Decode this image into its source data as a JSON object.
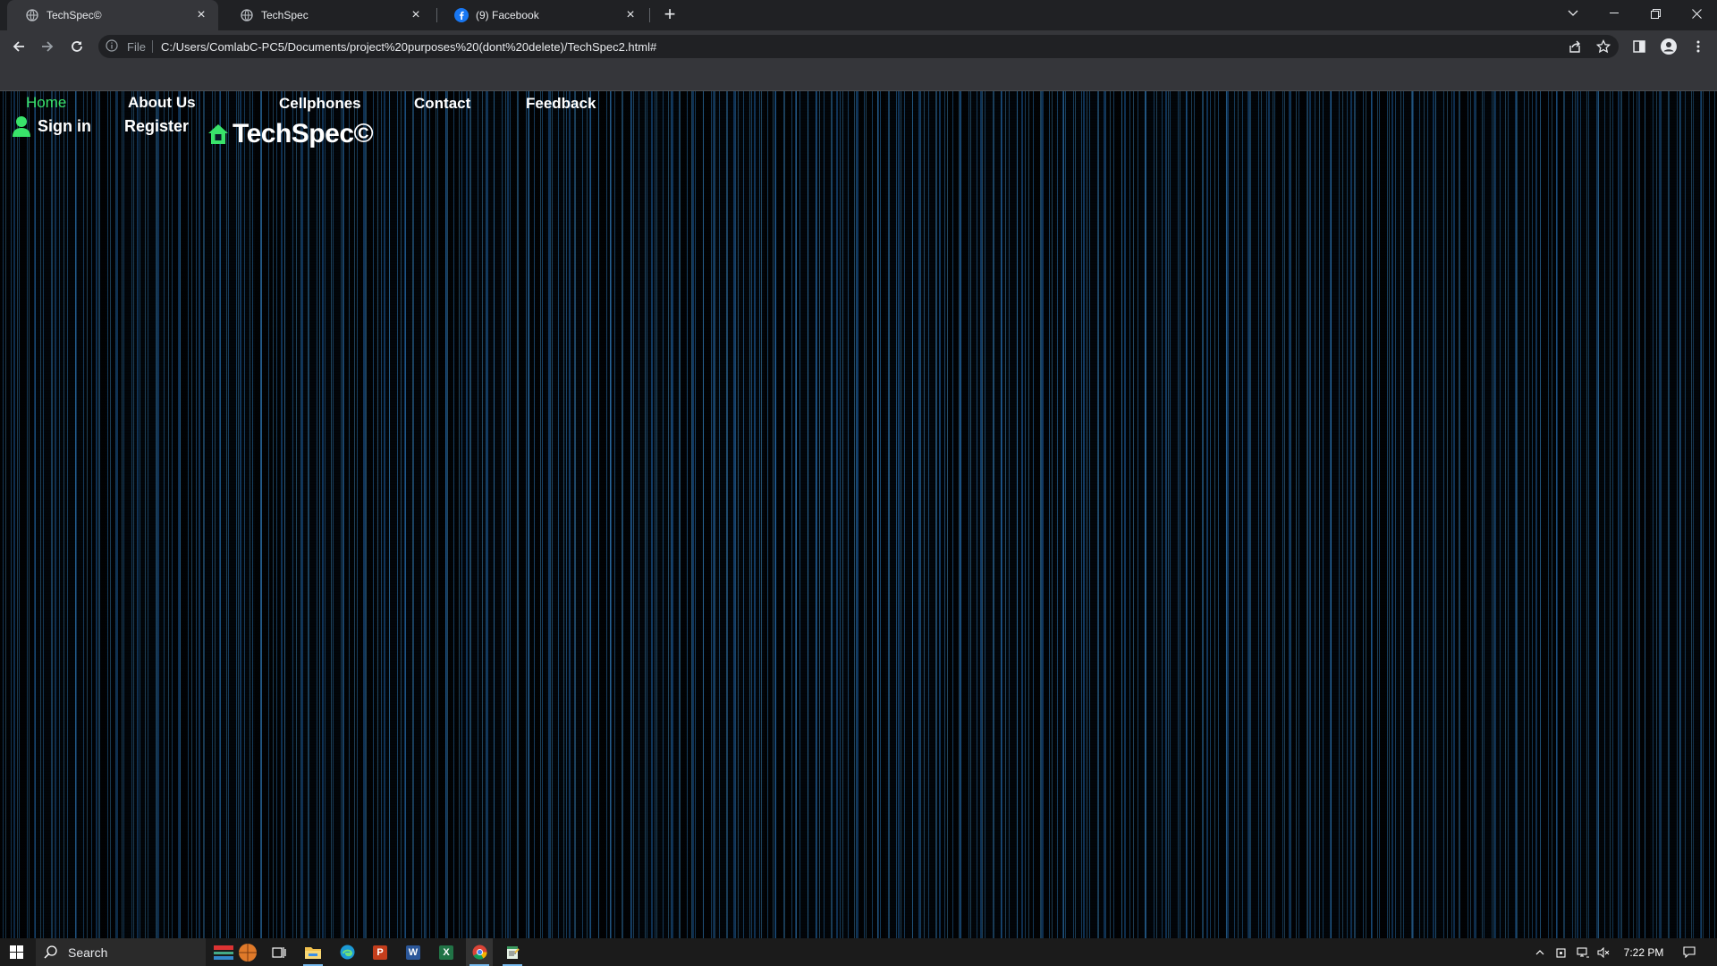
{
  "browser": {
    "tabs": [
      {
        "title": "TechSpec©",
        "active": true
      },
      {
        "title": "TechSpec",
        "active": false
      },
      {
        "title": "(9) Facebook",
        "active": false
      }
    ],
    "address": {
      "scheme_label": "File",
      "url": "C:/Users/ComlabC-PC5/Documents/project%20purposes%20(dont%20delete)/TechSpec2.html#"
    }
  },
  "site": {
    "nav": [
      "Home",
      "About Us",
      "Cellphones",
      "Contact",
      "Feedback"
    ],
    "signin_label": "Sign in",
    "register_label": "Register",
    "brand_name": "TechSpec©",
    "colors": {
      "accent": "#39e36a",
      "text": "#ffffff",
      "background_lines": "#2f82c8"
    }
  },
  "taskbar": {
    "search_label": "Search",
    "time": "7:22 PM"
  }
}
